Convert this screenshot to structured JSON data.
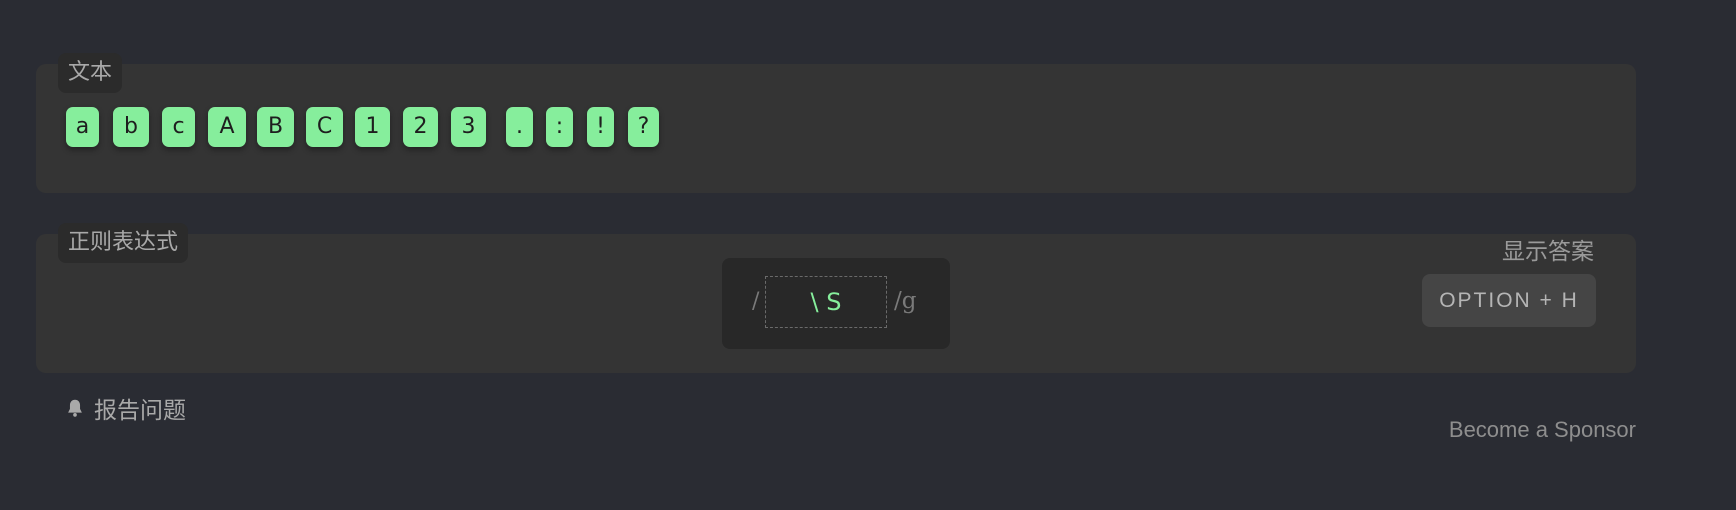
{
  "text_section": {
    "label": "文本",
    "chars": [
      "a",
      "b",
      "c",
      "A",
      "B",
      "C",
      "1",
      "2",
      "3",
      ".",
      ":",
      "!",
      "?"
    ]
  },
  "regex_section": {
    "label": "正则表达式",
    "open_slash": "/",
    "pattern": "\\ S",
    "flags": "/g",
    "show_answer": "显示答案",
    "shortcut": "OPTION + H"
  },
  "footer": {
    "report_issue": "报告问题",
    "report_icon": "bell-icon",
    "sponsor": "Become a Sponsor"
  },
  "colors": {
    "background": "#2a2c33",
    "panel": "#343434",
    "chip": "#86ee9c",
    "pattern_text": "#86ee9c"
  }
}
